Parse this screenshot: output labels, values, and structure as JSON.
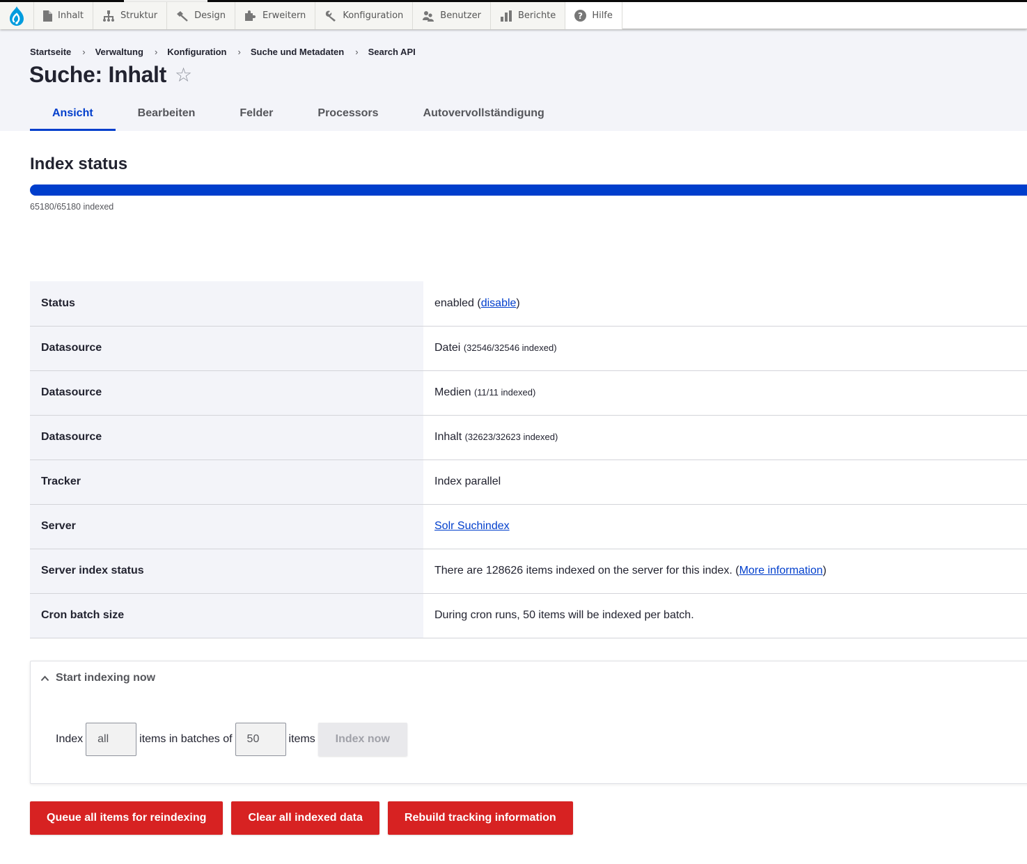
{
  "toolbar": {
    "logo": "drupal-logo-icon",
    "items": [
      {
        "label": "Inhalt",
        "icon": "file-icon"
      },
      {
        "label": "Struktur",
        "icon": "sitemap-icon"
      },
      {
        "label": "Design",
        "icon": "paintbrush-icon"
      },
      {
        "label": "Erweitern",
        "icon": "puzzle-icon"
      },
      {
        "label": "Konfiguration",
        "icon": "wrench-icon"
      },
      {
        "label": "Benutzer",
        "icon": "people-icon"
      },
      {
        "label": "Berichte",
        "icon": "bar-chart-icon"
      },
      {
        "label": "Hilfe",
        "icon": "help-icon"
      }
    ]
  },
  "breadcrumb": [
    "Startseite",
    "Verwaltung",
    "Konfiguration",
    "Suche und Metadaten",
    "Search API"
  ],
  "breadcrumb_separator": "›",
  "page": {
    "title": "Suche: Inhalt",
    "favorite_icon": "☆"
  },
  "tabs": [
    {
      "label": "Ansicht",
      "active": true
    },
    {
      "label": "Bearbeiten",
      "active": false
    },
    {
      "label": "Felder",
      "active": false
    },
    {
      "label": "Processors",
      "active": false
    },
    {
      "label": "Autovervollständigung",
      "active": false
    }
  ],
  "index_status": {
    "title": "Index status",
    "indexed": 65180,
    "total": 65180,
    "progress_percent": 100,
    "progress_text": "65180/65180 indexed"
  },
  "info_rows": [
    {
      "label": "Status",
      "value": "enabled (",
      "link": "disable",
      "suffix": ")"
    },
    {
      "label": "Datasource",
      "value": "Datei",
      "small": "(32546/32546 indexed)"
    },
    {
      "label": "Datasource",
      "value": "Medien",
      "small": "(11/11 indexed)"
    },
    {
      "label": "Datasource",
      "value": "Inhalt",
      "small": "(32623/32623 indexed)"
    },
    {
      "label": "Tracker",
      "value": "Index parallel"
    },
    {
      "label": "Server",
      "link": "Solr Suchindex"
    },
    {
      "label": "Server index status",
      "value": "There are 128626 items indexed on the server for this index. (",
      "link": "More information",
      "suffix": ")"
    },
    {
      "label": "Cron batch size",
      "value": "During cron runs, 50 items will be indexed per batch."
    }
  ],
  "start_indexing": {
    "summary": "Start indexing now",
    "label_index": "Index",
    "limit_value": "all",
    "label_batches": "items in batches of",
    "batch_value": "50",
    "label_items": "items",
    "index_now_button": "Index now"
  },
  "actions": {
    "queue_reindex": "Queue all items for reindexing",
    "clear_data": "Clear all indexed data",
    "rebuild_tracking": "Rebuild tracking information"
  },
  "colors": {
    "accent": "#003ecc",
    "danger": "#d72222",
    "header_bg": "#f3f4f9"
  }
}
